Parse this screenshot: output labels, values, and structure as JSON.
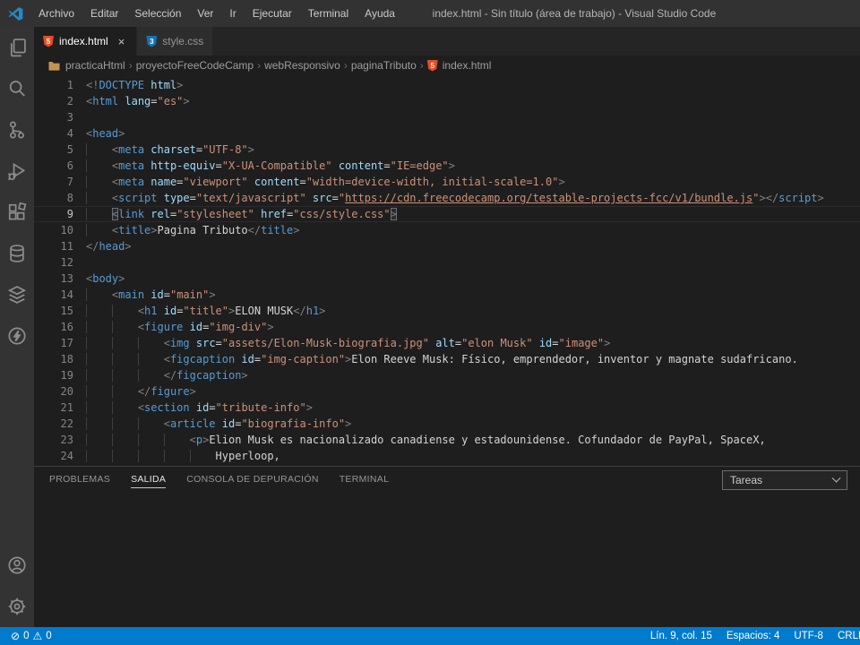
{
  "window": {
    "title": "index.html - Sin título (área de trabajo) - Visual Studio Code"
  },
  "menu": {
    "items": [
      "Archivo",
      "Editar",
      "Selección",
      "Ver",
      "Ir",
      "Ejecutar",
      "Terminal",
      "Ayuda"
    ]
  },
  "activity_bar": {
    "top_icons": [
      "explorer-icon",
      "search-icon",
      "source-control-icon",
      "run-debug-icon",
      "extensions-icon",
      "database-icon",
      "layers-icon",
      "thunder-client-icon"
    ],
    "bottom_icons": [
      "account-icon",
      "settings-gear-icon"
    ]
  },
  "tab_bar": {
    "tabs": [
      {
        "label": "index.html",
        "active": true,
        "icon": "html5-icon",
        "icon_glyph": "5",
        "icon_color": "#e44d26",
        "close_label": "×"
      },
      {
        "label": "style.css",
        "active": false,
        "icon": "css3-icon",
        "icon_glyph": "3",
        "icon_color": "#1572b6"
      }
    ]
  },
  "breadcrumb": {
    "separator": "›",
    "items": [
      "practicaHtml",
      "proyectoFreeCodeCamp",
      "webResponsivo",
      "paginaTributo",
      "index.html"
    ],
    "file_icon": {
      "glyph": "5",
      "color": "#e44d26"
    }
  },
  "editor": {
    "active_line": 9,
    "lines": [
      {
        "n": 1,
        "t": [
          [
            "p",
            "<!"
          ],
          [
            "t",
            "DOCTYPE"
          ],
          [
            "a",
            " html"
          ],
          [
            "p",
            ">"
          ]
        ]
      },
      {
        "n": 2,
        "t": [
          [
            "p",
            "<"
          ],
          [
            "t",
            "html"
          ],
          [
            "a",
            " lang"
          ],
          [
            "o",
            "="
          ],
          [
            "s",
            "\"es\""
          ],
          [
            "p",
            ">"
          ]
        ]
      },
      {
        "n": 3,
        "t": []
      },
      {
        "n": 4,
        "t": [
          [
            "p",
            "<"
          ],
          [
            "t",
            "head"
          ],
          [
            "p",
            ">"
          ]
        ]
      },
      {
        "n": 5,
        "t": [
          [
            "w",
            "    "
          ],
          [
            "p",
            "<"
          ],
          [
            "t",
            "meta"
          ],
          [
            "a",
            " charset"
          ],
          [
            "o",
            "="
          ],
          [
            "s",
            "\"UTF-8\""
          ],
          [
            "p",
            ">"
          ]
        ]
      },
      {
        "n": 6,
        "t": [
          [
            "w",
            "    "
          ],
          [
            "p",
            "<"
          ],
          [
            "t",
            "meta"
          ],
          [
            "a",
            " http-equiv"
          ],
          [
            "o",
            "="
          ],
          [
            "s",
            "\"X-UA-Compatible\""
          ],
          [
            "a",
            " content"
          ],
          [
            "o",
            "="
          ],
          [
            "s",
            "\"IE=edge\""
          ],
          [
            "p",
            ">"
          ]
        ]
      },
      {
        "n": 7,
        "t": [
          [
            "w",
            "    "
          ],
          [
            "p",
            "<"
          ],
          [
            "t",
            "meta"
          ],
          [
            "a",
            " name"
          ],
          [
            "o",
            "="
          ],
          [
            "s",
            "\"viewport\""
          ],
          [
            "a",
            " content"
          ],
          [
            "o",
            "="
          ],
          [
            "s",
            "\"width=device-width, initial-scale=1.0\""
          ],
          [
            "p",
            ">"
          ]
        ]
      },
      {
        "n": 8,
        "t": [
          [
            "w",
            "    "
          ],
          [
            "p",
            "<"
          ],
          [
            "t",
            "script"
          ],
          [
            "a",
            " type"
          ],
          [
            "o",
            "="
          ],
          [
            "s",
            "\"text/javascript\""
          ],
          [
            "a",
            " src"
          ],
          [
            "o",
            "="
          ],
          [
            "s",
            "\""
          ],
          [
            "l",
            "https://cdn.freecodecamp.org/testable-projects-fcc/v1/bundle.js"
          ],
          [
            "s",
            "\""
          ],
          [
            "p",
            ">"
          ],
          [
            "p",
            "</"
          ],
          [
            "t",
            "script"
          ],
          [
            "p",
            ">"
          ]
        ]
      },
      {
        "n": 9,
        "t": [
          [
            "w",
            "    "
          ],
          [
            "pb",
            "<"
          ],
          [
            "t",
            "link"
          ],
          [
            "a",
            " rel"
          ],
          [
            "o",
            "="
          ],
          [
            "s",
            "\"stylesheet\""
          ],
          [
            "a",
            " href"
          ],
          [
            "o",
            "="
          ],
          [
            "s",
            "\"css/style.css\""
          ],
          [
            "pb",
            ">"
          ]
        ]
      },
      {
        "n": 10,
        "t": [
          [
            "w",
            "    "
          ],
          [
            "p",
            "<"
          ],
          [
            "t",
            "title"
          ],
          [
            "p",
            ">"
          ],
          [
            "x",
            "Pagina Tributo"
          ],
          [
            "p",
            "</"
          ],
          [
            "t",
            "title"
          ],
          [
            "p",
            ">"
          ]
        ]
      },
      {
        "n": 11,
        "t": [
          [
            "p",
            "</"
          ],
          [
            "t",
            "head"
          ],
          [
            "p",
            ">"
          ]
        ]
      },
      {
        "n": 12,
        "t": []
      },
      {
        "n": 13,
        "t": [
          [
            "p",
            "<"
          ],
          [
            "t",
            "body"
          ],
          [
            "p",
            ">"
          ]
        ]
      },
      {
        "n": 14,
        "t": [
          [
            "w",
            "    "
          ],
          [
            "p",
            "<"
          ],
          [
            "t",
            "main"
          ],
          [
            "a",
            " id"
          ],
          [
            "o",
            "="
          ],
          [
            "s",
            "\"main\""
          ],
          [
            "p",
            ">"
          ]
        ]
      },
      {
        "n": 15,
        "t": [
          [
            "w",
            "        "
          ],
          [
            "p",
            "<"
          ],
          [
            "t",
            "h1"
          ],
          [
            "a",
            " id"
          ],
          [
            "o",
            "="
          ],
          [
            "s",
            "\"title\""
          ],
          [
            "p",
            ">"
          ],
          [
            "x",
            "ELON MUSK"
          ],
          [
            "p",
            "</"
          ],
          [
            "t",
            "h1"
          ],
          [
            "p",
            ">"
          ]
        ]
      },
      {
        "n": 16,
        "t": [
          [
            "w",
            "        "
          ],
          [
            "p",
            "<"
          ],
          [
            "t",
            "figure"
          ],
          [
            "a",
            " id"
          ],
          [
            "o",
            "="
          ],
          [
            "s",
            "\"img-div\""
          ],
          [
            "p",
            ">"
          ]
        ]
      },
      {
        "n": 17,
        "t": [
          [
            "w",
            "            "
          ],
          [
            "p",
            "<"
          ],
          [
            "t",
            "img"
          ],
          [
            "a",
            " src"
          ],
          [
            "o",
            "="
          ],
          [
            "s",
            "\"assets/Elon-Musk-biografia.jpg\""
          ],
          [
            "a",
            " alt"
          ],
          [
            "o",
            "="
          ],
          [
            "s",
            "\"elon Musk\""
          ],
          [
            "a",
            " id"
          ],
          [
            "o",
            "="
          ],
          [
            "s",
            "\"image\""
          ],
          [
            "p",
            ">"
          ]
        ]
      },
      {
        "n": 18,
        "t": [
          [
            "w",
            "            "
          ],
          [
            "p",
            "<"
          ],
          [
            "t",
            "figcaption"
          ],
          [
            "a",
            " id"
          ],
          [
            "o",
            "="
          ],
          [
            "s",
            "\"img-caption\""
          ],
          [
            "p",
            ">"
          ],
          [
            "x",
            "Elon Reeve Musk: Físico, emprendedor, inventor y magnate sudafricano."
          ]
        ]
      },
      {
        "n": 19,
        "t": [
          [
            "w",
            "            "
          ],
          [
            "p",
            "</"
          ],
          [
            "t",
            "figcaption"
          ],
          [
            "p",
            ">"
          ]
        ]
      },
      {
        "n": 20,
        "t": [
          [
            "w",
            "        "
          ],
          [
            "p",
            "</"
          ],
          [
            "t",
            "figure"
          ],
          [
            "p",
            ">"
          ]
        ]
      },
      {
        "n": 21,
        "t": [
          [
            "w",
            "        "
          ],
          [
            "p",
            "<"
          ],
          [
            "t",
            "section"
          ],
          [
            "a",
            " id"
          ],
          [
            "o",
            "="
          ],
          [
            "s",
            "\"tribute-info\""
          ],
          [
            "p",
            ">"
          ]
        ]
      },
      {
        "n": 22,
        "t": [
          [
            "w",
            "            "
          ],
          [
            "p",
            "<"
          ],
          [
            "t",
            "article"
          ],
          [
            "a",
            " id"
          ],
          [
            "o",
            "="
          ],
          [
            "s",
            "\"biografia-info\""
          ],
          [
            "p",
            ">"
          ]
        ]
      },
      {
        "n": 23,
        "t": [
          [
            "w",
            "                "
          ],
          [
            "p",
            "<"
          ],
          [
            "t",
            "p"
          ],
          [
            "p",
            ">"
          ],
          [
            "x",
            "Elion Musk es nacionalizado canadiense y estadounidense. Cofundador de PayPal, SpaceX,"
          ]
        ]
      },
      {
        "n": 24,
        "t": [
          [
            "w",
            "                    "
          ],
          [
            "x",
            "Hyperloop,"
          ]
        ]
      }
    ]
  },
  "panel": {
    "tabs": [
      {
        "label": "PROBLEMAS",
        "active": false
      },
      {
        "label": "SALIDA",
        "active": true
      },
      {
        "label": "CONSOLA DE DEPURACIÓN",
        "active": false
      },
      {
        "label": "TERMINAL",
        "active": false
      }
    ],
    "tasks_dropdown": {
      "value": "Tareas",
      "icon": "chevron-down-icon"
    }
  },
  "status_bar": {
    "errors": "0",
    "warnings": "0",
    "error_icon": "⊘",
    "warning_icon": "⚠",
    "items_right": [
      {
        "name": "cursor-position",
        "label": "Lín. 9, col. 15"
      },
      {
        "name": "indentation",
        "label": "Espacios: 4"
      },
      {
        "name": "encoding",
        "label": "UTF-8"
      },
      {
        "name": "eol",
        "label": "CRLF"
      }
    ]
  }
}
